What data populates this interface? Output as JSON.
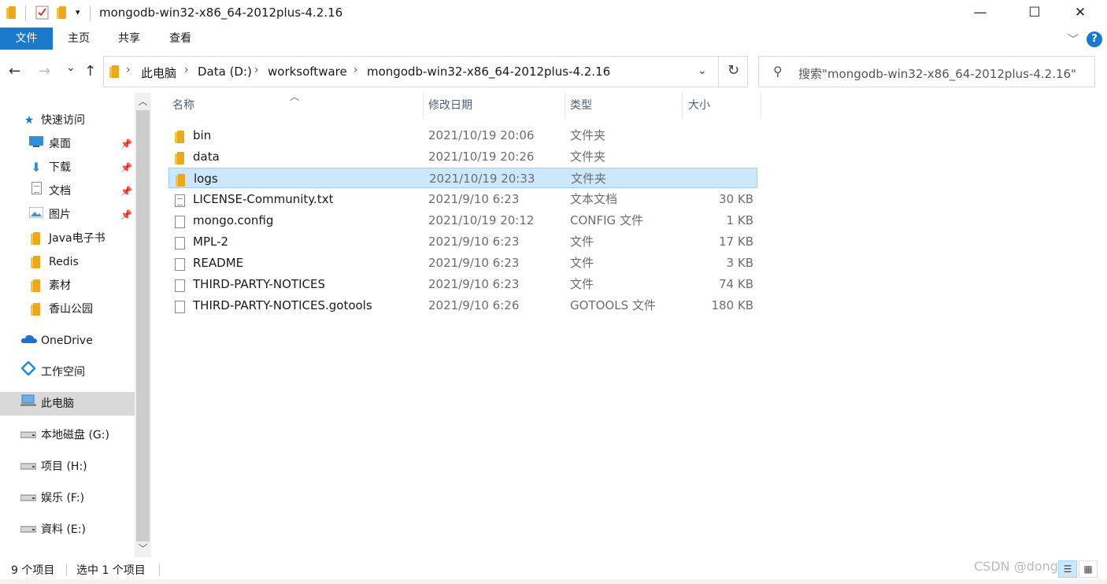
{
  "window": {
    "title": "mongodb-win32-x86_64-2012plus-4.2.16",
    "minimize_glyph": "—",
    "maximize_glyph": "☐",
    "close_glyph": "✕"
  },
  "ribbon": {
    "tabs": [
      "文件",
      "主页",
      "共享",
      "查看"
    ],
    "expand_glyph": "﹀",
    "help_glyph": "?"
  },
  "nav": {
    "back_glyph": "←",
    "forward_glyph": "→",
    "recent_glyph": "⌄",
    "up_glyph": "↑",
    "breadcrumbs": [
      "此电脑",
      "Data (D:)",
      "worksoftware",
      "mongodb-win32-x86_64-2012plus-4.2.16"
    ],
    "separator": "›",
    "dropdown_glyph": "⌄",
    "refresh_glyph": "↻",
    "search_placeholder": "搜索\"mongodb-win32-x86_64-2012plus-4.2.16\"",
    "search_glyph": "⚲"
  },
  "sidebar": {
    "quick_access": {
      "label": "快速访问",
      "icon": "star-icon"
    },
    "pinned": [
      {
        "label": "桌面",
        "icon": "desktop-icon"
      },
      {
        "label": "下载",
        "icon": "download-icon"
      },
      {
        "label": "文档",
        "icon": "document-icon"
      },
      {
        "label": "图片",
        "icon": "picture-icon"
      }
    ],
    "folders": [
      {
        "label": "Java电子书",
        "icon": "folder-icon"
      },
      {
        "label": "Redis",
        "icon": "folder-icon"
      },
      {
        "label": "素材",
        "icon": "folder-icon"
      },
      {
        "label": "香山公园",
        "icon": "folder-icon"
      }
    ],
    "onedrive": {
      "label": "OneDrive",
      "icon": "cloud-icon"
    },
    "workspace": {
      "label": "工作空间",
      "icon": "workspace-icon"
    },
    "this_pc": {
      "label": "此电脑",
      "icon": "computer-icon"
    },
    "drives": [
      {
        "label": "本地磁盘 (G:)",
        "icon": "drive-icon"
      },
      {
        "label": "项目 (H:)",
        "icon": "drive-icon"
      },
      {
        "label": "娱乐 (F:)",
        "icon": "drive-icon"
      },
      {
        "label": "資料 (E:)",
        "icon": "drive-icon"
      }
    ],
    "pin_glyph": "📌",
    "scroll_up_glyph": "︿",
    "scroll_down_glyph": "﹀"
  },
  "file_list": {
    "columns": {
      "name": "名称",
      "date": "修改日期",
      "type": "类型",
      "size": "大小"
    },
    "sort_glyph": "︿",
    "rows": [
      {
        "name": "bin",
        "date": "2021/10/19 20:06",
        "type": "文件夹",
        "size": "",
        "kind": "folder"
      },
      {
        "name": "data",
        "date": "2021/10/19 20:26",
        "type": "文件夹",
        "size": "",
        "kind": "folder"
      },
      {
        "name": "logs",
        "date": "2021/10/19 20:33",
        "type": "文件夹",
        "size": "",
        "kind": "folder",
        "selected": true
      },
      {
        "name": "LICENSE-Community.txt",
        "date": "2021/9/10 6:23",
        "type": "文本文档",
        "size": "30 KB",
        "kind": "text"
      },
      {
        "name": "mongo.config",
        "date": "2021/10/19 20:12",
        "type": "CONFIG 文件",
        "size": "1 KB",
        "kind": "file"
      },
      {
        "name": "MPL-2",
        "date": "2021/9/10 6:23",
        "type": "文件",
        "size": "17 KB",
        "kind": "file"
      },
      {
        "name": "README",
        "date": "2021/9/10 6:23",
        "type": "文件",
        "size": "3 KB",
        "kind": "file"
      },
      {
        "name": "THIRD-PARTY-NOTICES",
        "date": "2021/9/10 6:23",
        "type": "文件",
        "size": "74 KB",
        "kind": "file"
      },
      {
        "name": "THIRD-PARTY-NOTICES.gotools",
        "date": "2021/9/10 6:26",
        "type": "GOTOOLS 文件",
        "size": "180 KB",
        "kind": "file"
      }
    ]
  },
  "status": {
    "count": "9 个项目",
    "selection": "选中 1 个项目",
    "watermark": "CSDN @dongge",
    "details_view_glyph": "☰",
    "icon_view_glyph": "▦"
  },
  "colors": {
    "accent": "#1979ca",
    "selection_bg": "#cce8ff",
    "selection_border": "#99d1ff",
    "folder": "#f5c542"
  }
}
